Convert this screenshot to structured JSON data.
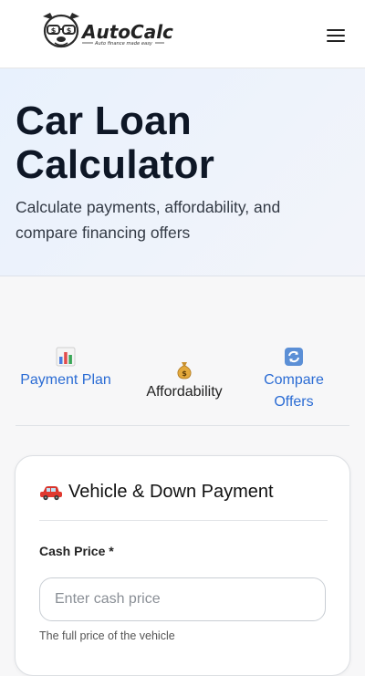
{
  "header": {
    "brand_name": "AutoCalc",
    "brand_tagline": "Auto finance made easy",
    "menu_icon": "hamburger-menu-icon"
  },
  "hero": {
    "title": "Car Loan Calculator",
    "subtitle": "Calculate payments, affordability, and compare financing offers"
  },
  "tabs": [
    {
      "icon": "bar-chart-icon",
      "label": "Payment Plan",
      "active": false
    },
    {
      "icon": "money-bag-icon",
      "label": "Affordability",
      "active": true
    },
    {
      "icon": "cycle-arrows-icon",
      "label": "Compare Offers",
      "active": false
    }
  ],
  "card": {
    "title": "Vehicle & Down Payment",
    "title_icon": "car-icon",
    "cash_price_label": "Cash Price *",
    "cash_price_placeholder": "Enter cash price",
    "cash_price_value": "",
    "cash_price_help": "The full price of the vehicle"
  },
  "colors": {
    "link_blue": "#2b6cd4",
    "hero_bg": "#e8f1fd",
    "title_dark": "#0e1726"
  }
}
